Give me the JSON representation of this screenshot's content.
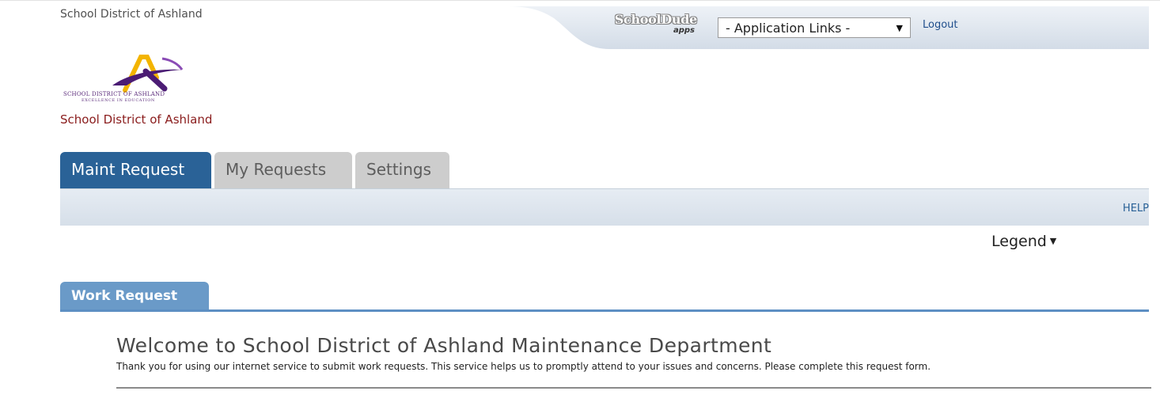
{
  "header": {
    "district_name": "School District of Ashland",
    "brand_name": "SchoolDude",
    "brand_sub": "apps",
    "app_links_selected": "- Application Links -",
    "logout_label": "Logout"
  },
  "logo": {
    "title": "School District of Ashland",
    "text": "SCHOOL DISTRICT OF ASHLAND",
    "tagline": "EXCELLENCE IN EDUCATION"
  },
  "tabs": [
    {
      "label": "Maint Request",
      "active": true
    },
    {
      "label": "My Requests",
      "active": false
    },
    {
      "label": "Settings",
      "active": false
    }
  ],
  "toolbar": {
    "help_label": "HELP"
  },
  "legend": {
    "label": "Legend",
    "icon": "caret-down-icon"
  },
  "work_request": {
    "tab_label": "Work Request",
    "welcome_title": "Welcome to School District of Ashland Maintenance Department",
    "intro_text": "Thank you for using our internet service to submit work requests. This service helps us to promptly attend to your issues and concerns. Please complete this request form."
  },
  "colors": {
    "active_tab": "#2a6297",
    "inactive_tab": "#cdcdcd",
    "work_request_tab": "#6a9ac8",
    "district_link": "#8a1c1c"
  }
}
